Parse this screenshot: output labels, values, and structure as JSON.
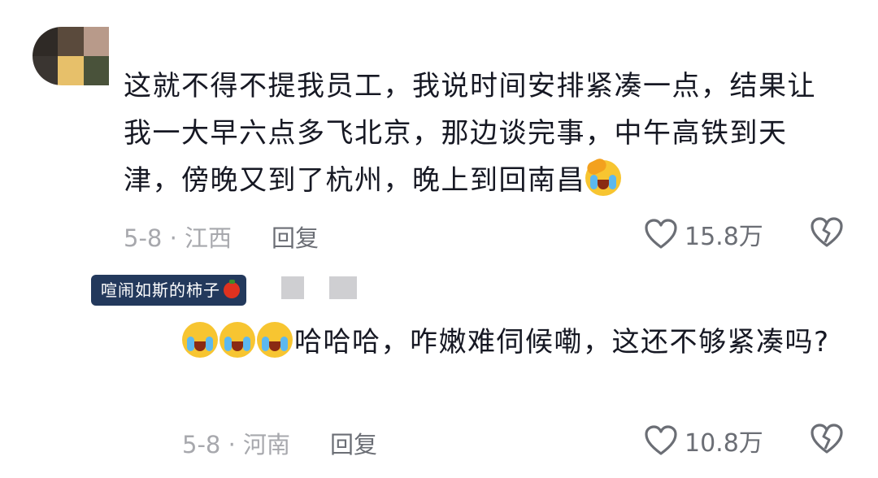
{
  "comment1": {
    "text": "这就不得不提我员工，我说时间安排紧凑一点，结果让我一大早六点多飞北京，那边谈完事，中午高铁到天津，傍晚又到了杭州，晚上到回南昌",
    "date_location": "5-8 · 江西",
    "reply_label": "回复",
    "likes": "15.8万",
    "emoji": "face-palm-laughing-emoji"
  },
  "comment2": {
    "username": "喧闹如斯的柿子",
    "text": "哈哈哈，咋嫩难伺候嘞，这还不够紧凑吗?",
    "date_location": "5-8 · 河南",
    "reply_label": "回复",
    "likes": "10.8万",
    "emojis": [
      "crying-laughing-emoji",
      "crying-laughing-emoji",
      "crying-laughing-emoji"
    ]
  },
  "icons": {
    "like": "heart-outline-icon",
    "dislike": "broken-heart-icon"
  },
  "colors": {
    "text": "#161823",
    "meta": "#a7a8ad",
    "tag_bg": "#23395c"
  }
}
